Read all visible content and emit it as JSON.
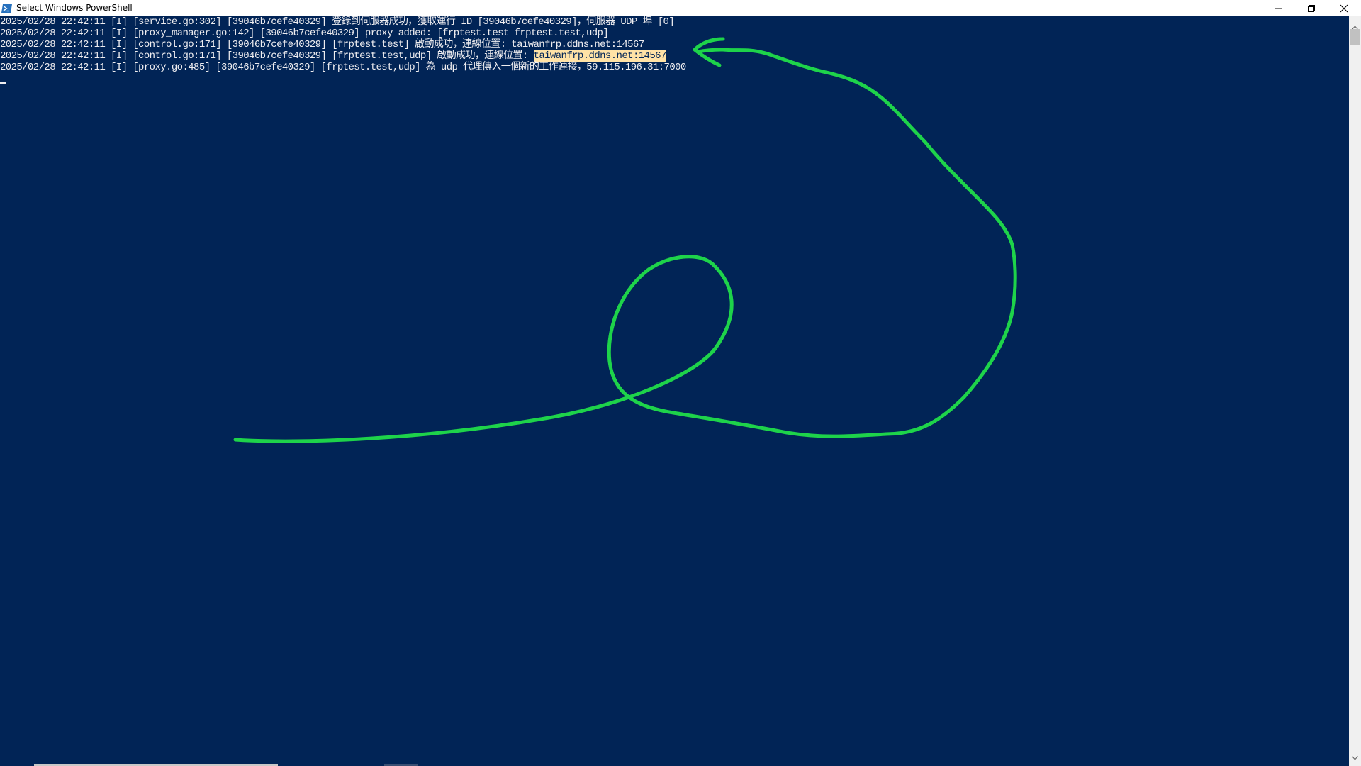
{
  "window": {
    "title": "Select Windows PowerShell",
    "icon": "powershell-icon",
    "controls": [
      "minimize-icon",
      "restore-icon",
      "close-icon"
    ]
  },
  "console": {
    "background": "#012456",
    "foreground": "#eeedf0",
    "lines": [
      {
        "text": "2025/02/28 22:42:11 [I] [service.go:302] [39046b7cefe40329] 登錄到伺服器成功，獲取運行 ID [39046b7cefe40329]，伺服器 UDP 埠 [0]"
      },
      {
        "text": "2025/02/28 22:42:11 [I] [proxy_manager.go:142] [39046b7cefe40329] proxy added: [frptest.test frptest.test,udp]"
      },
      {
        "text": "2025/02/28 22:42:11 [I] [control.go:171] [39046b7cefe40329] [frptest.test] 啟動成功，連線位置: taiwanfrp.ddns.net:14567"
      },
      {
        "text_before": "2025/02/28 22:42:11 [I] [control.go:171] [39046b7cefe40329] [frptest.test,udp] 啟動成功，連線位置: ",
        "highlight": "taiwanfrp.ddns.net:14567"
      },
      {
        "text": "2025/02/28 22:42:11 [I] [proxy.go:485] [39046b7cefe40329] [frptest.test,udp] 為 udp 代理傳入一個新的工作連接，59.115.196.31:7000"
      }
    ],
    "highlight_color": "#ffe2a6"
  },
  "annotation": {
    "color": "#1ed34a",
    "description_icon": "hand-drawn-arrow"
  }
}
